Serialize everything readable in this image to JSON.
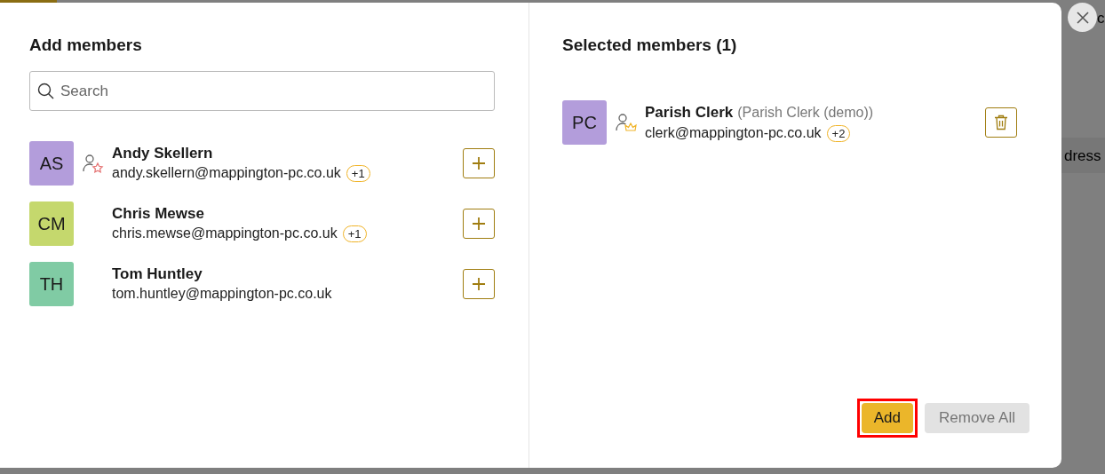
{
  "background_texts": [
    "c",
    "dress"
  ],
  "add_panel": {
    "title": "Add members",
    "search": {
      "placeholder": "Search"
    },
    "members": [
      {
        "initials": "AS",
        "color": "#b39ddb",
        "name": "Andy Skellern",
        "email": "andy.skellern@mappington-pc.co.uk",
        "badge": "+1",
        "kind": "star"
      },
      {
        "initials": "CM",
        "color": "#c5d86d",
        "name": "Chris Mewse",
        "email": "chris.mewse@mappington-pc.co.uk",
        "badge": "+1"
      },
      {
        "initials": "TH",
        "color": "#80cba4",
        "name": "Tom Huntley",
        "email": "tom.huntley@mappington-pc.co.uk"
      }
    ]
  },
  "selected_panel": {
    "title": "Selected members (1)",
    "members": [
      {
        "initials": "PC",
        "color": "#b39ddb",
        "name": "Parish Clerk",
        "role_label": "(Parish Clerk (demo))",
        "email": "clerk@mappington-pc.co.uk",
        "badge": "+2",
        "kind": "crown"
      }
    ]
  },
  "buttons": [
    {
      "label": "Add",
      "kind": "primary",
      "highlighted": true
    },
    {
      "label": "Remove All",
      "kind": "secondary",
      "highlighted": false
    }
  ]
}
